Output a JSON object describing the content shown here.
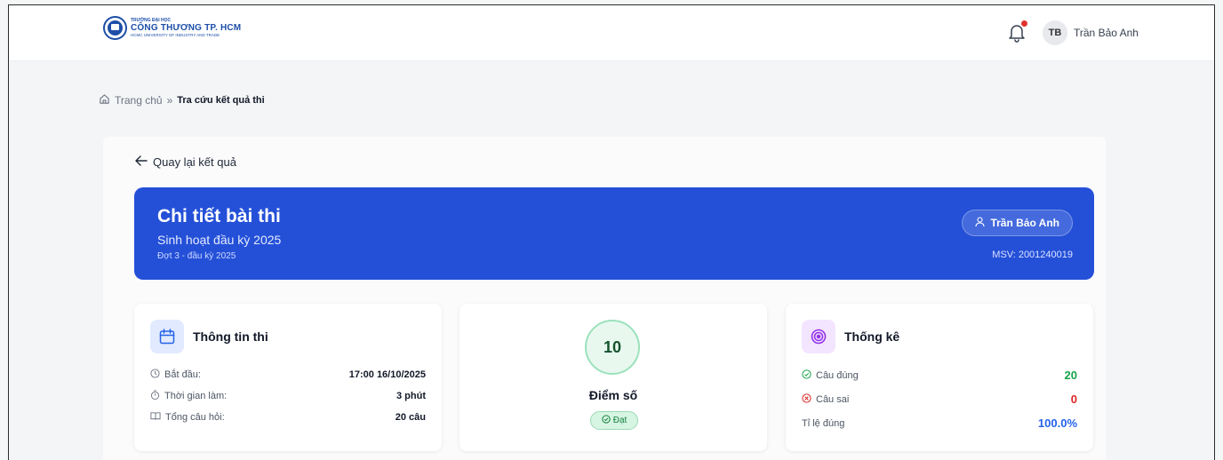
{
  "header": {
    "logo": {
      "line1": "TRƯỜNG ĐẠI HỌC",
      "line2": "CÔNG THƯƠNG TP. HCM",
      "line3": "HCMC UNIVERSITY OF INDUSTRY AND TRADE"
    },
    "notification_icon": "bell-icon",
    "avatar_initials": "TB",
    "user_name": "Trần Bảo Anh"
  },
  "breadcrumb": {
    "home_label": "Trang chủ",
    "separator": "»",
    "current": "Tra cứu kết quả thi"
  },
  "back_label": "Quay lại kết quả",
  "hero": {
    "title": "Chi tiết bài thi",
    "subtitle": "Sinh hoạt đầu kỳ 2025",
    "period": "Đợt 3 - đầu kỳ 2025",
    "student_name": "Trần Bảo Anh",
    "student_id": "MSV: 2001240019",
    "color": "#2450d8"
  },
  "exam_info": {
    "title": "Thông tin thi",
    "rows": [
      {
        "label": "Bắt đầu:",
        "value": "17:00 16/10/2025",
        "icon": "clock-icon"
      },
      {
        "label": "Thời gian làm:",
        "value": "3 phút",
        "icon": "timer-icon"
      },
      {
        "label": "Tổng câu hỏi:",
        "value": "20 câu",
        "icon": "book-icon"
      }
    ]
  },
  "score": {
    "value": "10",
    "label": "Điểm số",
    "status": "Đạt"
  },
  "stats": {
    "title": "Thống kê",
    "correct_label": "Câu đúng",
    "correct_value": "20",
    "wrong_label": "Câu sai",
    "wrong_value": "0",
    "rate_label": "Tỉ lệ đúng",
    "rate_value": "100.0%"
  }
}
